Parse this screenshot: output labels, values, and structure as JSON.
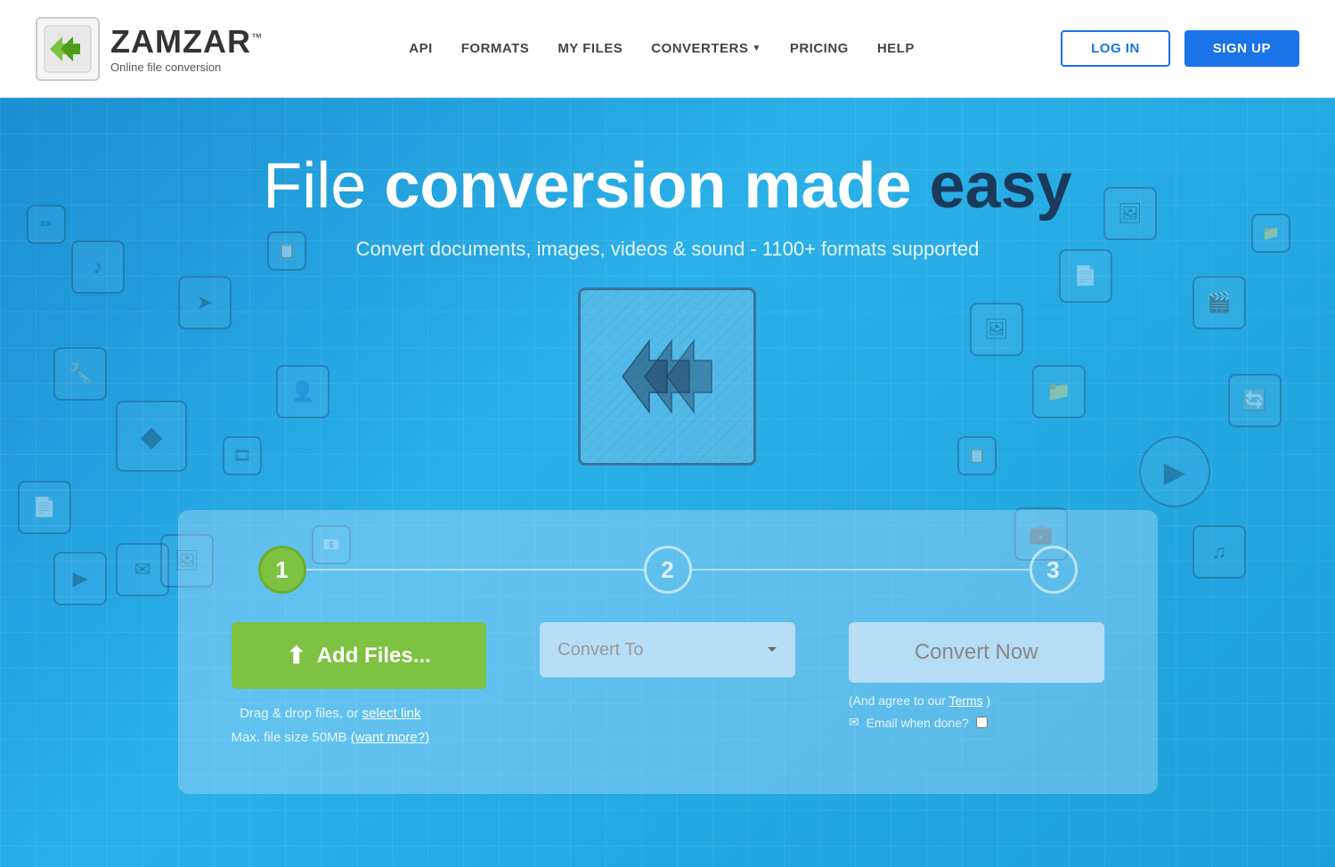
{
  "header": {
    "logo_brand": "ZAMZAR",
    "logo_trademark": "™",
    "logo_sub": "Online file conversion",
    "nav": {
      "api": "API",
      "formats": "FORMATS",
      "my_files": "MY FILES",
      "converters": "CONVERTERS",
      "pricing": "PRICING",
      "help": "HELP"
    },
    "btn_login": "LOG IN",
    "btn_signup": "SIGN UP"
  },
  "hero": {
    "title_part1": "File ",
    "title_part2": "conversion made ",
    "title_part3": "easy",
    "subtitle": "Convert documents, images, videos & sound - 1100+ formats supported"
  },
  "form": {
    "step1_label": "1",
    "step2_label": "2",
    "step3_label": "3",
    "btn_add_files": "Add Files...",
    "drag_text": "Drag & drop files, or",
    "drag_link": "select link",
    "max_size": "Max. file size 50MB",
    "want_more": "(want more?)",
    "convert_to_placeholder": "Convert To",
    "btn_convert_now": "Convert Now",
    "agree_text": "(And agree to our",
    "agree_link": "Terms",
    "agree_end": ")",
    "email_label": "Email when done?",
    "upload_icon": "⬆"
  },
  "colors": {
    "green": "#7dc240",
    "blue": "#1a73e8",
    "hero_bg": "#2196c9"
  }
}
